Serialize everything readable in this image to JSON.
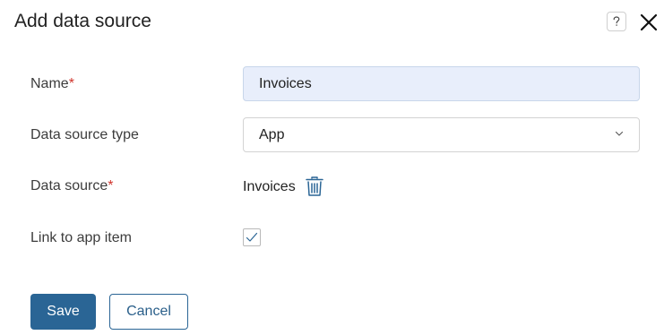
{
  "dialog": {
    "title": "Add data source",
    "help_icon": "question-mark-icon",
    "close_icon": "close-icon"
  },
  "fields": {
    "name": {
      "label": "Name",
      "required_mark": "*",
      "value": "Invoices"
    },
    "data_source_type": {
      "label": "Data source type",
      "value": "App",
      "icon": "chevron-down-icon"
    },
    "data_source": {
      "label": "Data source",
      "required_mark": "*",
      "value": "Invoices",
      "icon": "trash-icon"
    },
    "link_to_app_item": {
      "label": "Link to app item",
      "checked": true,
      "icon": "checkmark-icon"
    }
  },
  "actions": {
    "save_label": "Save",
    "cancel_label": "Cancel"
  },
  "colors": {
    "primary": "#2a6595",
    "required": "#d0342c",
    "input_filled_bg": "#e8eefb"
  }
}
